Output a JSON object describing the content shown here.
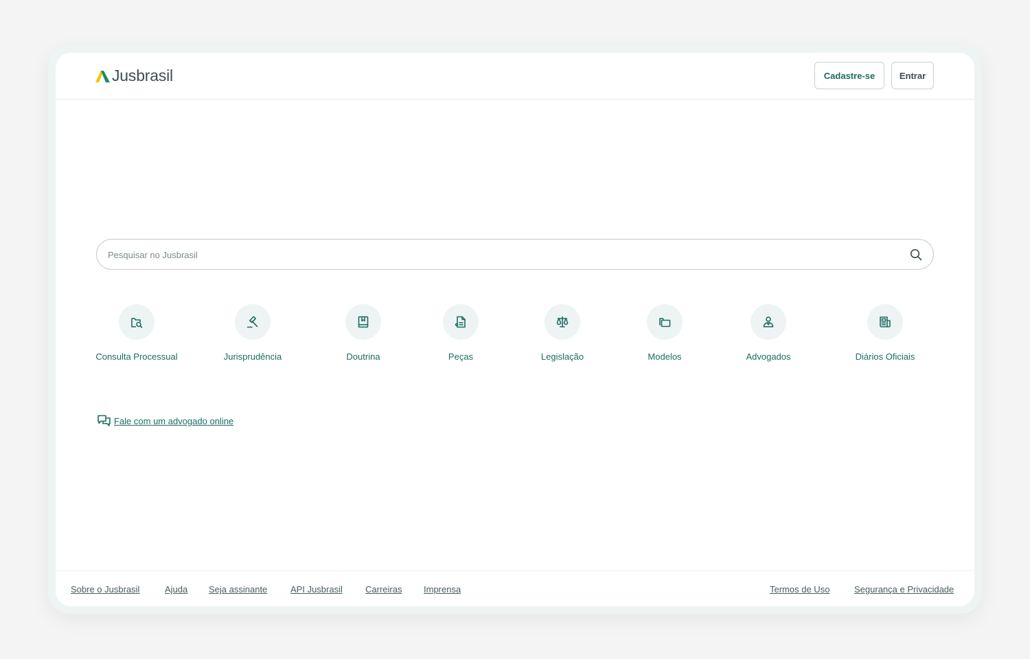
{
  "brand": {
    "name": "Jusbrasil"
  },
  "header": {
    "signup_label": "Cadastre-se",
    "login_label": "Entrar"
  },
  "search": {
    "placeholder": "Pesquisar no Jusbrasil",
    "value": ""
  },
  "categories": [
    {
      "label": "Consulta Processual",
      "icon": "folder-search-icon"
    },
    {
      "label": "Jurisprudência",
      "icon": "gavel-icon"
    },
    {
      "label": "Doutrina",
      "icon": "book-icon"
    },
    {
      "label": "Peças",
      "icon": "document-icon"
    },
    {
      "label": "Legislação",
      "icon": "scales-icon"
    },
    {
      "label": "Modelos",
      "icon": "folders-icon"
    },
    {
      "label": "Advogados",
      "icon": "lawyer-icon"
    },
    {
      "label": "Diários Oficiais",
      "icon": "newspaper-icon"
    }
  ],
  "chat_link": {
    "label": "Fale com um advogado online",
    "icon": "chat-bubbles-icon"
  },
  "footer": {
    "left_links": [
      "Sobre o Jusbrasil",
      "Ajuda",
      "Seja assinante",
      "API Jusbrasil",
      "Carreiras",
      "Imprensa"
    ],
    "right_links": [
      "Termos de Uso",
      "Segurança e Privacidade"
    ]
  },
  "colors": {
    "accent": "#1b6c61",
    "logo_yellow": "#f2c200",
    "logo_green": "#1b8a6b",
    "icon_bg": "#eef4f3"
  }
}
